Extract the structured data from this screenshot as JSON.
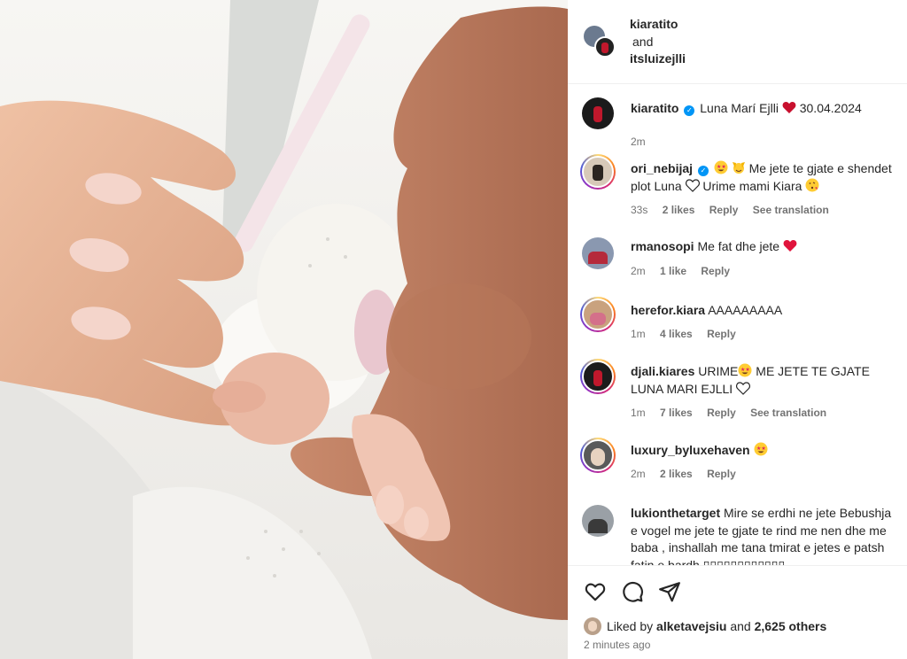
{
  "post": {
    "collaborators": [
      "kiaratito",
      "itsluizejlli"
    ],
    "and_text": "and"
  },
  "caption": {
    "user": "kiaratito",
    "text": "Luna Marí Ejlli",
    "date": "30.04.2024",
    "time": "2m"
  },
  "comments": [
    {
      "user": "ori_nebijaj",
      "verified": true,
      "text_a": "Me jete te gjate e shendet plot Luna",
      "text_b": "Urime mami Kiara",
      "time": "33s",
      "likes": "2 likes",
      "reply": "Reply",
      "translate": "See translation"
    },
    {
      "user": "rmanosopi",
      "text": "Me fat dhe jete",
      "time": "2m",
      "likes": "1 like",
      "reply": "Reply"
    },
    {
      "user": "herefor.kiara",
      "text": "AAAAAAAAA",
      "time": "1m",
      "likes": "4 likes",
      "reply": "Reply"
    },
    {
      "user": "djali.kiares",
      "text_a": "URIME",
      "text_b": "ME JETE TE GJATE LUNA MARI EJLLI",
      "time": "1m",
      "likes": "7 likes",
      "reply": "Reply",
      "translate": "See translation"
    },
    {
      "user": "luxury_byluxehaven",
      "text": "",
      "time": "2m",
      "likes": "2 likes",
      "reply": "Reply"
    },
    {
      "user": "lukionthetarget",
      "text": "Mire se erdhi ne jete Bebushja e vogel me jete te gjate te rind me nen dhe me baba , inshallah me tana tmirat e jetes e patsh fatin e bardh ▯▯▯▯▯▯▯▯▯▯▯▯"
    }
  ],
  "footer": {
    "liked_by_prefix": "Liked by",
    "liked_by_user": "alketavejsiu",
    "and": "and",
    "others": "2,625 others",
    "posted": "2 minutes ago"
  },
  "icons": [
    "heart-icon",
    "comment-icon",
    "share-icon",
    "verified-badge-icon",
    "red-heart-emoji",
    "star-struck-emoji",
    "raised-hands-emoji",
    "white-heart-emoji",
    "kiss-emoji"
  ],
  "colors": {
    "accent_blue": "#0095f6",
    "meta_gray": "#737373",
    "text": "#262626",
    "heart_red": "#ed2b4a"
  }
}
